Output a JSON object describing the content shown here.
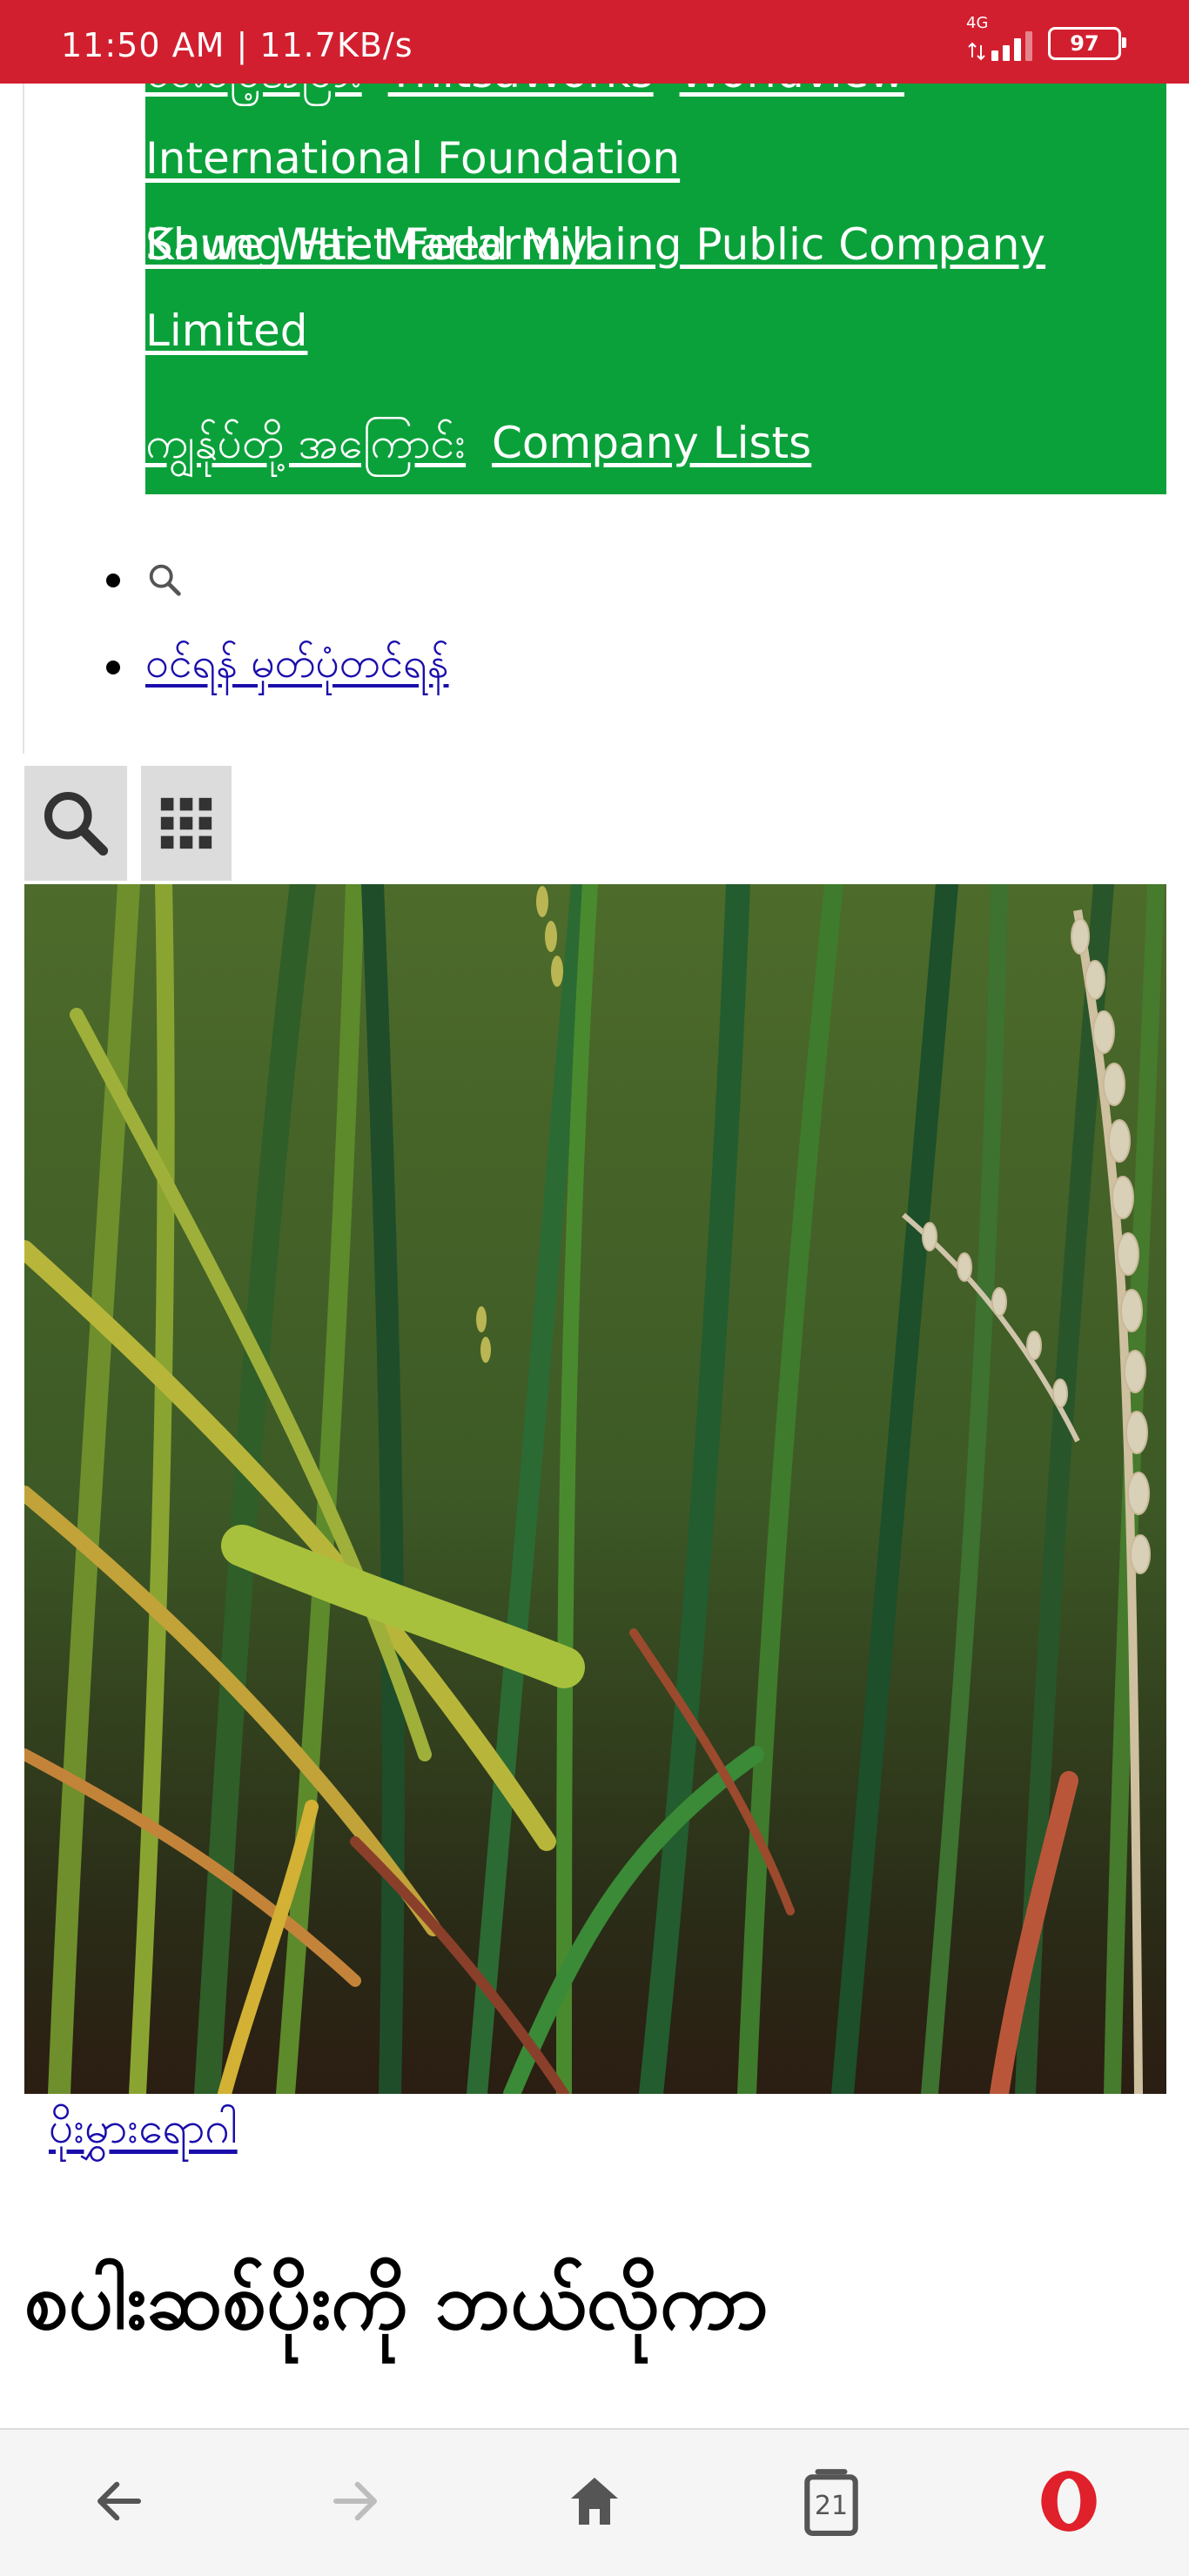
{
  "status_bar": {
    "time_speed": "11:50 AM | 11.7KB/s",
    "network_type": "4G",
    "battery": "97",
    "background_color": "#d21f2f"
  },
  "green_menu": {
    "background_color": "#0aa13a",
    "links": {
      "partial_top_1": "ဝေးမြေ့အခြား",
      "partial_top_2": "ThitsaWorks",
      "partial_top_3": "Worldview",
      "international_foundation": "International Foundation",
      "kaung_htet": "Kaung Htet Feed Mill",
      "shwe_wai": "Shwe Wai",
      "marlarmyaing": "Marlarmyaing Public Company",
      "limited": "Limited",
      "about_us": "ကျွန်ုပ်တို့ အကြောင်း",
      "company_lists": "Company Lists"
    }
  },
  "nav_list": {
    "search_icon": "search-icon",
    "login_register": "ဝင်ရန် မှတ်ပုံတင်ရန်"
  },
  "toolbar": {
    "search_icon": "search-icon",
    "apps_icon": "grid-icon",
    "button_bg": "#dcdcdc"
  },
  "article": {
    "hero_image": "rice-plants-photo",
    "category": "ပိုးမွှားရောဂါ",
    "headline_line1": "စပါးဆစ်ပိုးကို ဘယ်လိုကာ"
  },
  "bottom_nav": {
    "back_icon": "back-arrow-icon",
    "forward_icon": "forward-arrow-icon",
    "home_icon": "home-icon",
    "tabs_count": "21",
    "opera_icon": "opera-logo-icon"
  }
}
